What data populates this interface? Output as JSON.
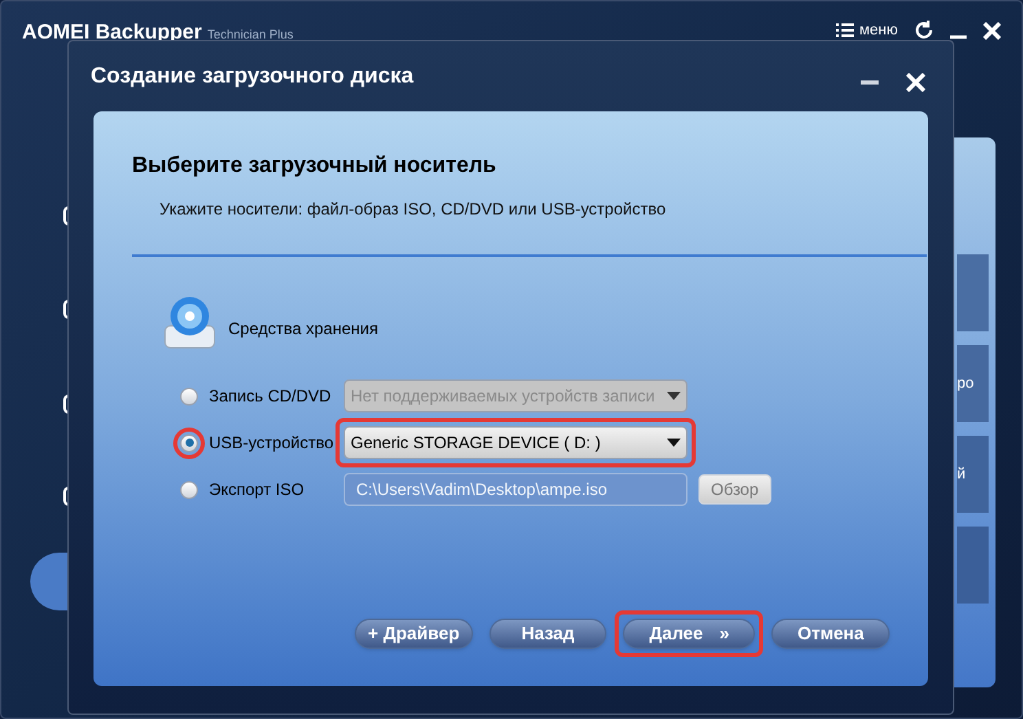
{
  "app": {
    "title": "AOMEI Backupper",
    "edition": "Technician Plus",
    "menu_label": "меню",
    "side_fragments": [
      "ро",
      "й"
    ]
  },
  "dialog": {
    "title": "Создание загрузочного диска",
    "heading": "Выберите загрузочный носитель",
    "subtitle": "Укажите носители: файл-образ ISO, CD/DVD или USB-устройство",
    "section": "Средства хранения",
    "options": [
      {
        "kind": "dropdown",
        "label": "Запись CD/DVD",
        "selected": false,
        "highlighted": false,
        "disabled": true,
        "value": "Нет поддерживаемых устройств записи"
      },
      {
        "kind": "dropdown",
        "label": "USB-устройство",
        "selected": true,
        "highlighted": true,
        "disabled": false,
        "value": "Generic STORAGE DEVICE  ( D: )"
      },
      {
        "kind": "path",
        "label": "Экспорт ISO",
        "selected": false,
        "highlighted": false,
        "disabled": true,
        "value": "C:\\Users\\Vadim\\Desktop\\ampe.iso",
        "button": "Обзор"
      }
    ],
    "buttons": [
      {
        "label": "+ Драйвер",
        "highlighted": false
      },
      {
        "label": "Назад",
        "highlighted": false
      },
      {
        "label": "Далее",
        "suffix": "»",
        "highlighted": true
      },
      {
        "label": "Отмена",
        "highlighted": false
      }
    ]
  }
}
